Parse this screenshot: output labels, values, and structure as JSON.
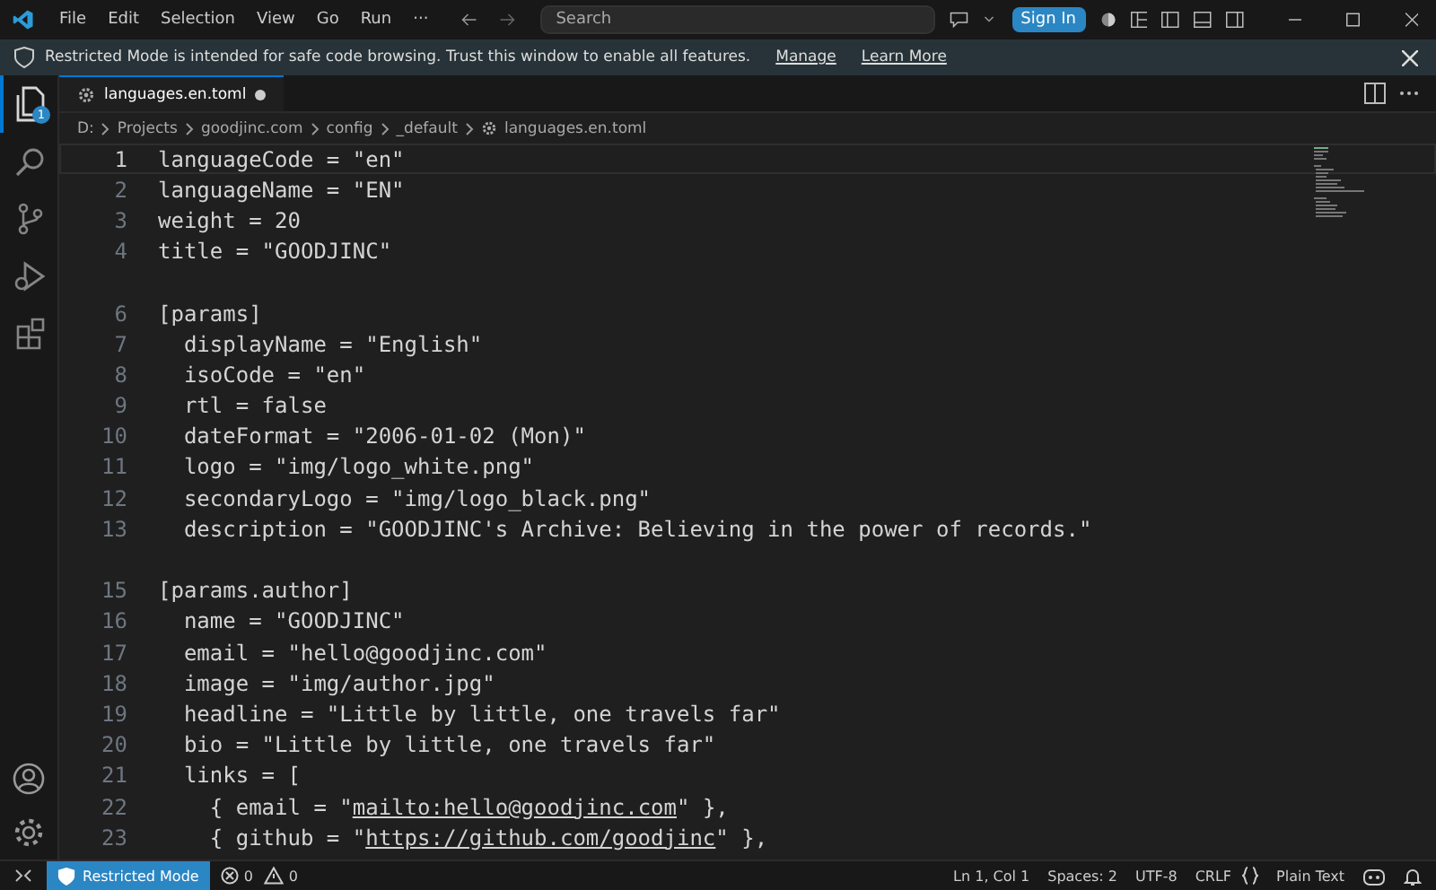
{
  "menu": [
    "File",
    "Edit",
    "Selection",
    "View",
    "Go",
    "Run",
    "···"
  ],
  "search": {
    "placeholder": "Search"
  },
  "sign_in": "Sign In",
  "banner": {
    "text": "Restricted Mode is intended for safe code browsing. Trust this window to enable all features.",
    "links": [
      "Manage",
      "Learn More"
    ]
  },
  "tabs": [
    {
      "label": "languages.en.toml",
      "selected": true,
      "modified": true
    }
  ],
  "activity": [
    {
      "kind": "files",
      "selected": true,
      "badge": "1"
    },
    {
      "kind": "search",
      "selected": false
    },
    {
      "kind": "scm",
      "selected": false
    },
    {
      "kind": "debug",
      "selected": false
    },
    {
      "kind": "extensions",
      "selected": false
    }
  ],
  "breadcrumb": [
    "D:",
    "Projects",
    "goodjinc.com",
    "config",
    "_default",
    "languages.en.toml"
  ],
  "lines": [
    {
      "number": "1",
      "current": true,
      "segments": [
        {
          "text": "languageCode = \"en\""
        }
      ]
    },
    {
      "number": "2",
      "segments": [
        {
          "text": "languageName = \"EN\""
        }
      ]
    },
    {
      "number": "3",
      "segments": [
        {
          "text": "weight = 20"
        }
      ]
    },
    {
      "number": "4",
      "segments": [
        {
          "text": "title = \"GOODJINC\""
        }
      ]
    },
    {
      "number": "6",
      "gap_before": true,
      "segments": [
        {
          "text": "[params]"
        }
      ]
    },
    {
      "number": "7",
      "segments": [
        {
          "text": "  displayName = \"English\""
        }
      ]
    },
    {
      "number": "8",
      "segments": [
        {
          "text": "  isoCode = \"en\""
        }
      ]
    },
    {
      "number": "9",
      "segments": [
        {
          "text": "  rtl = false"
        }
      ]
    },
    {
      "number": "10",
      "segments": [
        {
          "text": "  dateFormat = \"2006-01-02 (Mon)\""
        }
      ]
    },
    {
      "number": "11",
      "segments": [
        {
          "text": "  logo = \"img/logo_white.png\""
        }
      ]
    },
    {
      "number": "12",
      "segments": [
        {
          "text": "  secondaryLogo = \"img/logo_black.png\""
        }
      ]
    },
    {
      "number": "13",
      "segments": [
        {
          "text": "  description = \"GOODJINC's Archive: Believing in the power of records.\""
        }
      ]
    },
    {
      "number": "15",
      "gap_before": true,
      "segments": [
        {
          "text": "[params.author]"
        }
      ]
    },
    {
      "number": "16",
      "segments": [
        {
          "text": "  name = \"GOODJINC\""
        }
      ]
    },
    {
      "number": "17",
      "segments": [
        {
          "text": "  email = \"hello@goodjinc.com\""
        }
      ]
    },
    {
      "number": "18",
      "segments": [
        {
          "text": "  image = \"img/author.jpg\""
        }
      ]
    },
    {
      "number": "19",
      "segments": [
        {
          "text": "  headline = \"Little by little, one travels far\""
        }
      ]
    },
    {
      "number": "20",
      "segments": [
        {
          "text": "  bio = \"Little by little, one travels far\""
        }
      ]
    },
    {
      "number": "21",
      "segments": [
        {
          "text": "  links = ["
        }
      ]
    },
    {
      "number": "22",
      "segments": [
        {
          "text": "    { email = \""
        },
        {
          "text": "mailto:hello@goodjinc.com",
          "link": true
        },
        {
          "text": "\" },"
        }
      ]
    },
    {
      "number": "23",
      "segments": [
        {
          "text": "    { github = \""
        },
        {
          "text": "https://github.com/goodjinc",
          "link": true
        },
        {
          "text": "\" },"
        }
      ]
    }
  ],
  "status": {
    "mode": "Restricted Mode",
    "errors": "0",
    "warnings": "0",
    "right": [
      "Ln 1, Col 1",
      "Spaces: 2",
      "UTF-8",
      "CRLF",
      "Plain Text"
    ]
  }
}
